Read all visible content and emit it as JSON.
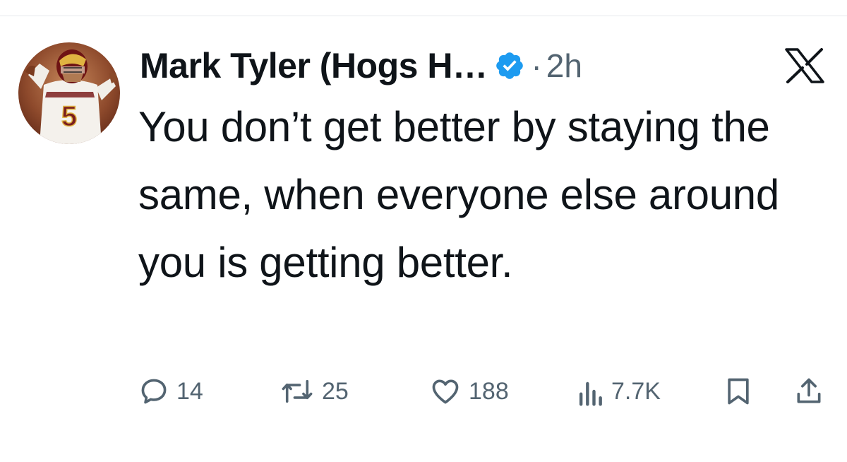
{
  "tweet": {
    "display_name": "Mark Tyler (Hogs H…",
    "separator": "·",
    "timestamp": "2h",
    "text": "You don’t get better by staying the same, when everyone else around you is getting better.",
    "avatar_jersey_number": "5"
  },
  "actions": {
    "replies": "14",
    "reposts": "25",
    "likes": "188",
    "views": "7.7K"
  },
  "icons": {
    "verified": "verified-badge-icon",
    "brand": "x-logo-icon",
    "reply": "reply-icon",
    "repost": "repost-icon",
    "like": "heart-icon",
    "views": "views-icon",
    "bookmark": "bookmark-icon",
    "share": "share-icon"
  },
  "colors": {
    "text": "#0f1419",
    "secondary": "#536471",
    "verified": "#1d9bf0",
    "background": "#ffffff"
  }
}
